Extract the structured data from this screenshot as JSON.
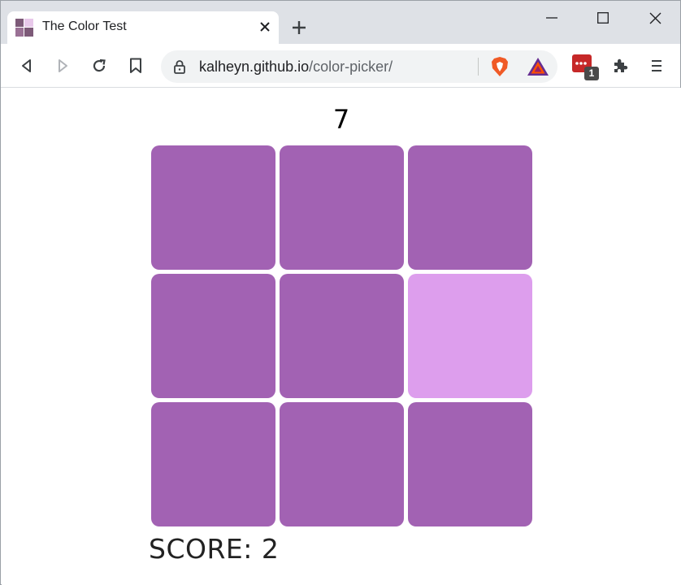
{
  "browser": {
    "tab": {
      "title": "The Color Test",
      "favicon": "color-test-favicon"
    },
    "window_controls": {
      "minimize": "minimize-icon",
      "maximize": "maximize-icon",
      "close": "close-icon"
    },
    "toolbar": {
      "back": "back-icon",
      "forward": "forward-icon",
      "reload": "reload-icon",
      "bookmark": "bookmark-icon",
      "url_host": "kalheyn.github.io",
      "url_path": "/color-picker/",
      "extension_badge": "1",
      "menu": "menu-icon"
    }
  },
  "game": {
    "timer": "7",
    "score_label": "SCORE: 2",
    "base_color": "#a262b3",
    "odd_color": "#dd9eed",
    "tiles": [
      "#a262b3",
      "#a262b3",
      "#a262b3",
      "#a262b3",
      "#a262b3",
      "#dd9eed",
      "#a262b3",
      "#a262b3",
      "#a262b3"
    ]
  }
}
